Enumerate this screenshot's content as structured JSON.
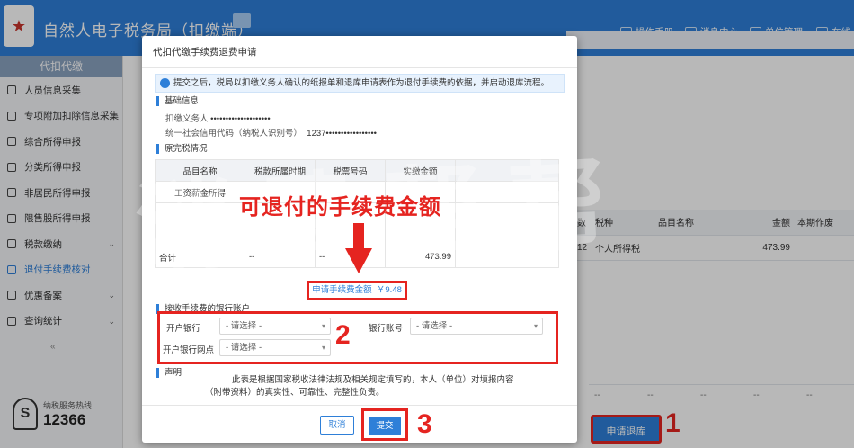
{
  "app": {
    "title": "自然人电子税务局（扣缴端）"
  },
  "topnav": [
    {
      "label": "操作手册",
      "icon": "manual-icon"
    },
    {
      "label": "消息中心",
      "icon": "mail-icon"
    },
    {
      "label": "单位管理",
      "icon": "building-icon"
    },
    {
      "label": "在线",
      "icon": "chat-icon"
    }
  ],
  "sidebar": {
    "header": "代扣代缴",
    "items": [
      {
        "label": "人员信息采集",
        "icon": "person-icon",
        "chevron": false,
        "active": false
      },
      {
        "label": "专项附加扣除信息采集",
        "icon": "grid-icon",
        "chevron": false,
        "active": false
      },
      {
        "label": "综合所得申报",
        "icon": "layers-icon",
        "chevron": false,
        "active": false
      },
      {
        "label": "分类所得申报",
        "icon": "pie-icon",
        "chevron": false,
        "active": false
      },
      {
        "label": "非居民所得申报",
        "icon": "user-icon",
        "chevron": false,
        "active": false
      },
      {
        "label": "限售股所得申报",
        "icon": "bar-chart-icon",
        "chevron": false,
        "active": false
      },
      {
        "label": "税款缴纳",
        "icon": "wallet-icon",
        "chevron": true,
        "active": false
      },
      {
        "label": "退付手续费核对",
        "icon": "document-icon",
        "chevron": false,
        "active": true
      },
      {
        "label": "优惠备案",
        "icon": "gift-icon",
        "chevron": true,
        "active": false
      },
      {
        "label": "查询统计",
        "icon": "search-list-icon",
        "chevron": true,
        "active": false
      }
    ],
    "collapse": "«",
    "hotline_label": "纳税服务热线",
    "hotline_number": "12366"
  },
  "background_table": {
    "headers": [
      "数",
      "税种",
      "品目名称",
      "金额",
      "本期作废"
    ],
    "row": [
      "12",
      "个人所得税",
      "",
      "473.99",
      ""
    ],
    "footer": [
      "--",
      "--",
      "--",
      "--",
      "--"
    ]
  },
  "refund_button": "申请退库",
  "annotations": {
    "num1": "1",
    "num2": "2",
    "num3": "3",
    "caption": "可退付的手续费金额"
  },
  "modal": {
    "title": "代扣代缴手续费退费申请",
    "notice": "提交之后，税局以扣缴义务人确认的纸报单和退库申请表作为退付手续费的依据，并启动退库流程。",
    "basic_section": "基础信息",
    "withholder_label": "扣缴义务人",
    "withholder_value": "••••••••••••••••••••",
    "credit_code_label": "统一社会信用代码（纳税人识别号）",
    "credit_code_value": "1237•••••••••••••••••",
    "original_section": "原完税情况",
    "table_headers": [
      "品目名称",
      "税款所属时期",
      "税票号码",
      "实缴金额"
    ],
    "table_row": [
      "工资薪金所得",
      "",
      "",
      ""
    ],
    "total_row": [
      "合计",
      "--",
      "--",
      "473.99"
    ],
    "amount_label": "申请手续费金额",
    "amount_value": "￥9.48",
    "bank_section": "接收手续费的银行账户",
    "bank_label": "开户银行",
    "bank_placeholder": "- 请选择 -",
    "account_label": "银行账号",
    "account_placeholder": "- 请选择 -",
    "branch_label": "开户银行网点",
    "branch_placeholder": "- 请选择 -",
    "declaration_section": "声明",
    "declaration": "此表是根据国家税收法律法规及相关规定填写的，本人（单位）对填报内容（附带资料）的真实性、可靠性、完整性负责。",
    "cancel": "取消",
    "submit": "提交"
  },
  "watermark": "消费帮帮"
}
